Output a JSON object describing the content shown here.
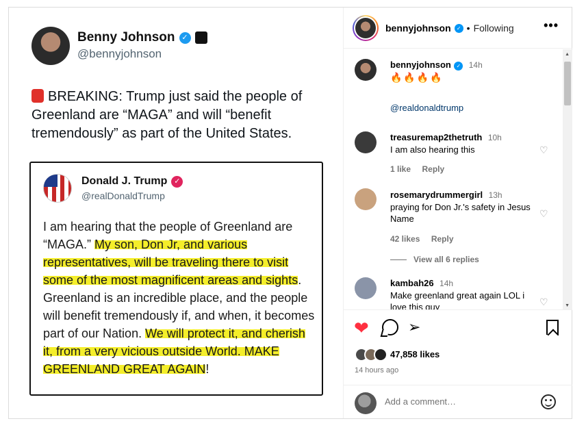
{
  "tweet": {
    "name": "Benny Johnson",
    "handle": "@bennyjohnson",
    "verified_mark": "✓",
    "text_icon": "siren-icon",
    "text": "BREAKING: Trump just said the people of Greenland are “MAGA” and will “benefit tremendously” as part of the United States.",
    "quote": {
      "name": "Donald J. Trump",
      "handle": "@realDonaldTrump",
      "verified_mark": "✓",
      "segments": [
        {
          "text": "I am hearing that the people of Greenland are “MAGA.” ",
          "highlight": false
        },
        {
          "text": "My son, Don Jr, and various representatives, will be traveling there to visit some of the most magnificent areas and sights",
          "highlight": true
        },
        {
          "text": ". Greenland is an incredible place, and the people will benefit tremendously if, and when, it becomes part of our Nation. ",
          "highlight": false
        },
        {
          "text": "We will protect it, and cherish it, from a very vicious outside World. MAKE GREENLAND GREAT AGAIN",
          "highlight": true
        },
        {
          "text": "!",
          "highlight": false
        }
      ]
    }
  },
  "header": {
    "username": "bennyjohnson",
    "verified_mark": "✓",
    "separator": "•",
    "follow_status": "Following",
    "more": "•••"
  },
  "caption": {
    "username": "bennyjohnson",
    "time": "14h",
    "emojis": "🔥🔥🔥🔥",
    "mention": "@realdonaldtrump"
  },
  "comments": [
    {
      "username": "treasuremap2thetruth",
      "time": "10h",
      "text": "I am also hearing this",
      "likes": "1 like",
      "reply": "Reply",
      "avatar_color": "#3a3a3a"
    },
    {
      "username": "rosemarydrummergirl",
      "time": "13h",
      "text": "praying for Don Jr.'s safety in Jesus Name",
      "likes": "42 likes",
      "reply": "Reply",
      "avatar_color": "#c9a27e"
    },
    {
      "username": "kambah26",
      "time": "14h",
      "text": "Make greenland great again LOL i love this guy",
      "avatar_color": "#8a94a8"
    }
  ],
  "view_replies": "View all 6 replies",
  "actions": {
    "like_icon": "❤",
    "share_icon": "➢",
    "likes": "47,858 likes",
    "time_ago": "14 hours ago"
  },
  "add_comment": {
    "placeholder": "Add a comment…"
  },
  "colors": {
    "accent_blue": "#0095f6",
    "like_red": "#ff3040",
    "highlight_yellow": "#f4ee2a",
    "muted": "#737373"
  }
}
